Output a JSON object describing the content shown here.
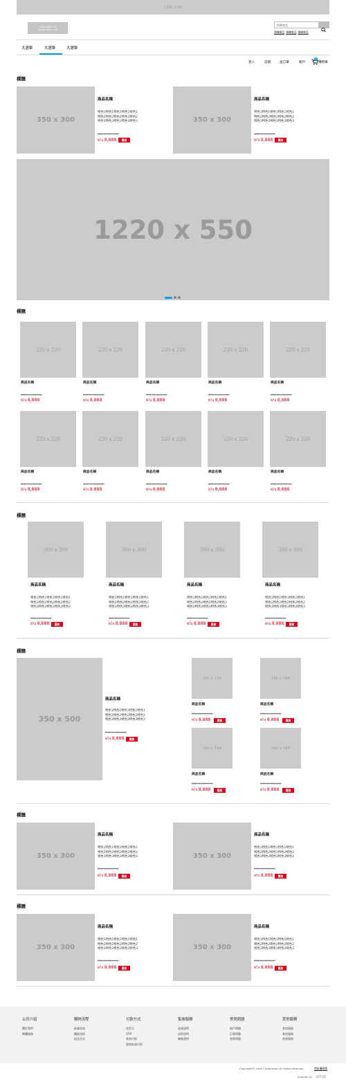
{
  "top_banner": {
    "label": "1220 x 60"
  },
  "header": {
    "logo_line1": "LOGO 500 x 50",
    "logo_line2": "mobile 400 x 100",
    "search_placeholder": "搜尋商品",
    "popular": [
      "預備商品",
      "預備商品",
      "預備商品"
    ]
  },
  "nav": {
    "tabs": [
      "大選單",
      "大選單",
      "大選單"
    ]
  },
  "utility": {
    "login": "登入",
    "register": "註冊",
    "order_query": "查訂單",
    "account": "帳戶",
    "cart": "購物車",
    "cart_count": "0"
  },
  "section1": {
    "title": "標題",
    "products": [
      {
        "img": "350 x 300",
        "name": "商品名稱",
        "desc": "特色1特色1特色1特色1特色1\n特色2特色2特色2特色2特色2\n特色3特色3特色3特色3特色3",
        "old_price": "NT$ 99,999,999",
        "currency": "NT$",
        "price": "8,888",
        "buy": "購買"
      },
      {
        "img": "350 x 300",
        "name": "商品名稱",
        "desc": "特色1特色1特色1特色1特色1\n特色2特色2特色2特色2特色2\n特色3特色3特色3特色3特色3",
        "old_price": "NT$ 99,999,999",
        "currency": "NT$",
        "price": "8,888",
        "buy": "購買"
      }
    ]
  },
  "hero": {
    "label": "1220 x 550",
    "slides": 3,
    "active_slide": 1
  },
  "section2": {
    "title": "標題",
    "products": [
      {
        "img": "220 x 220",
        "name": "商品名稱",
        "old_price": "NT$ 99,999,999",
        "currency": "NT$",
        "price": "8,888"
      },
      {
        "img": "220 x 220",
        "name": "商品名稱",
        "old_price": "NT$ 99,999,999",
        "currency": "NT$",
        "price": "8,888"
      },
      {
        "img": "220 x 220",
        "name": "商品名稱",
        "old_price": "NT$ 99,999,999",
        "currency": "NT$",
        "price": "8,888"
      },
      {
        "img": "220 x 220",
        "name": "商品名稱",
        "old_price": "NT$ 99,999,999",
        "currency": "NT$",
        "price": "8,888"
      },
      {
        "img": "220 x 220",
        "name": "商品名稱",
        "old_price": "NT$ 99,999,999",
        "currency": "NT$",
        "price": "8,888"
      },
      {
        "img": "220 x 220",
        "name": "商品名稱",
        "old_price": "NT$ 99,999,999",
        "currency": "NT$",
        "price": "8,888"
      },
      {
        "img": "220 x 220",
        "name": "商品名稱",
        "old_price": "NT$ 99,999,999",
        "currency": "NT$",
        "price": "8,888"
      },
      {
        "img": "220 x 220",
        "name": "商品名稱",
        "old_price": "NT$ 99,999,999",
        "currency": "NT$",
        "price": "8,888"
      },
      {
        "img": "220 x 220",
        "name": "商品名稱",
        "old_price": "NT$ 99,999,999",
        "currency": "NT$",
        "price": "8,888"
      },
      {
        "img": "220 x 220",
        "name": "商品名稱",
        "old_price": "NT$ 99,999,999",
        "currency": "NT$",
        "price": "8,888"
      }
    ]
  },
  "section3": {
    "title": "標題",
    "products": [
      {
        "img": "300 x 300",
        "name": "商品名稱",
        "desc": "特色1特色1特色1特色1特色1\n特色2特色2特色2特色2特色2\n特色3特色3特色3特色3特色3",
        "old_price": "NT$ 99,999,999",
        "currency": "NT$",
        "price": "8,888",
        "buy": "購買"
      },
      {
        "img": "300 x 300",
        "name": "商品名稱",
        "desc": "特色1特色1特色1特色1特色1\n特色2特色2特色2特色2特色2\n特色3特色3特色3特色3特色3",
        "old_price": "NT$ 99,999,999",
        "currency": "NT$",
        "price": "8,888",
        "buy": "購買"
      },
      {
        "img": "300 x 300",
        "name": "商品名稱",
        "desc": "特色1特色1特色1特色1特色1\n特色2特色2特色2特色2特色2\n特色3特色3特色3特色3特色3",
        "old_price": "NT$ 99,999,999",
        "currency": "NT$",
        "price": "8,888",
        "buy": "購買"
      },
      {
        "img": "300 x 300",
        "name": "商品名稱",
        "desc": "特色1特色1特色1特色1特色1\n特色2特色2特色2特色2特色2\n特色3特色3特色3特色3特色3",
        "old_price": "NT$ 99,999,999",
        "currency": "NT$",
        "price": "8,888",
        "buy": "購買"
      }
    ]
  },
  "section4": {
    "title": "標題",
    "main": {
      "img": "350 x 500",
      "name": "商品名稱",
      "desc": "特色1特色1特色1特色1特色1\n特色2特色2特色2特色2特色2\n特色3特色3特色3特色3特色3",
      "old_price": "NT$ 99,999,999",
      "currency": "NT$",
      "price": "8,888",
      "buy": "購買"
    },
    "small": [
      {
        "img": "160 x 160",
        "name": "商品名稱",
        "old_price": "NT$ 99,999,999",
        "currency": "NT$",
        "price": "8,888",
        "buy": "購買"
      },
      {
        "img": "160 x 160",
        "name": "商品名稱",
        "old_price": "NT$ 99,999,999",
        "currency": "NT$",
        "price": "8,888",
        "buy": "購買"
      },
      {
        "img": "160 x 160",
        "name": "商品名稱",
        "old_price": "NT$ 99,999,999",
        "currency": "NT$",
        "price": "8,888",
        "buy": "購買"
      },
      {
        "img": "160 x 160",
        "name": "商品名稱",
        "old_price": "NT$ 99,999,999",
        "currency": "NT$",
        "price": "8,888",
        "buy": "購買"
      }
    ]
  },
  "section5": {
    "title": "標題",
    "products": [
      {
        "img": "350 x 300",
        "name": "商品名稱",
        "desc": "特色1特色1特色1特色1特色1\n特色2特色2特色2特色2特色2\n特色3特色3特色3特色3特色3",
        "old_price": "NT$ 99,999,999",
        "currency": "NT$",
        "price": "8,888",
        "buy": "購買"
      },
      {
        "img": "350 x 300",
        "name": "商品名稱",
        "desc": "特色1特色1特色1特色1特色1\n特色2特色2特色2特色2特色2\n特色3特色3特色3特色3特色3",
        "old_price": "NT$ 99,999,999",
        "currency": "NT$",
        "price": "8,888",
        "buy": "購買"
      }
    ]
  },
  "section6": {
    "title": "標題",
    "products": [
      {
        "img": "350 x 300",
        "name": "商品名稱",
        "desc": "特色1特色1特色1特色1特色1\n特色2特色2特色2特色2特色2\n特色3特色3特色3特色3特色3",
        "old_price": "NT$ 99,999,999",
        "currency": "NT$",
        "price": "8,888",
        "buy": "購買"
      },
      {
        "img": "350 x 300",
        "name": "商品名稱",
        "desc": "特色1特色1特色1特色1特色1\n特色2特色2特色2特色2特色2\n特色3特色3特色3特色3特色3",
        "old_price": "NT$ 99,999,999",
        "currency": "NT$",
        "price": "8,888",
        "buy": "購買"
      }
    ]
  },
  "footer": {
    "columns": [
      {
        "title": "公司介紹",
        "links": [
          "關於我們",
          "網購服務"
        ]
      },
      {
        "title": "購物流程",
        "links": [
          "新會註冊",
          "購買流程",
          "配送方式"
        ]
      },
      {
        "title": "付款方式",
        "links": [
          "信用卡",
          "ATM",
          "貨到付款",
          "超商取貨付款"
        ]
      },
      {
        "title": "售後服務",
        "links": [
          "退貨說明",
          "退款說明",
          "聯絡我們"
        ]
      },
      {
        "title": "常見問題",
        "links": [
          "帳戶問題",
          "訂單問題",
          "發票問題"
        ]
      },
      {
        "title": "其他服務",
        "links": [
          "其他服務",
          "其他服務",
          "其他服務"
        ]
      }
    ],
    "copyright": "Copyright© uitox Corporation All rights reserved.",
    "privacy": "隱私權政策",
    "powered_by": "powered by",
    "brand": "uitox"
  },
  "colors": {
    "accent": "#00a0e0",
    "price": "#d9001b",
    "placeholder": "#cbcbcb",
    "footer_bg": "#f2f2f2"
  }
}
